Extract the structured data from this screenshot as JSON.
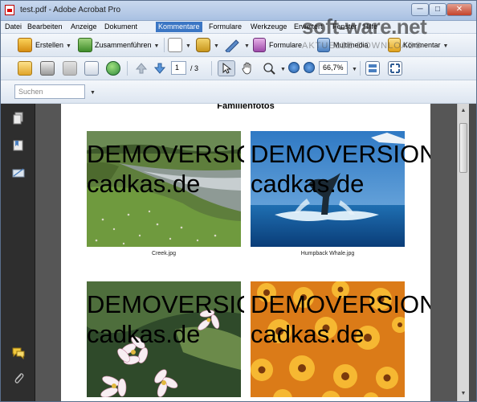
{
  "window": {
    "title": "test.pdf - Adobe Acrobat Pro",
    "minimize": "─",
    "maximize": "□",
    "close": "✕"
  },
  "menu": [
    "Datei",
    "Bearbeiten",
    "Anzeige",
    "Dokument",
    "Kommentare",
    "Formulare",
    "Werkzeuge",
    "Erweitert",
    "Fenster",
    "Hilfe"
  ],
  "menu_active": "Kommentare",
  "toolbar1": {
    "create": "Erstellen",
    "combine": "Zusammenführen",
    "forms": "Formulare",
    "multimedia": "Multimedia",
    "comment": "Kommentar"
  },
  "toolbar2": {
    "current_page": "1",
    "page_count": "/ 3",
    "zoom": "66,7%"
  },
  "search": {
    "placeholder": "Suchen"
  },
  "document": {
    "heading": "Familienfotos",
    "photos": [
      {
        "caption": "Creek.jpg"
      },
      {
        "caption": "Humpback Whale.jpg"
      },
      {
        "caption": ""
      },
      {
        "caption": ""
      }
    ],
    "demo_line1": "DEMOVERSION",
    "demo_line2": "cadkas.de"
  },
  "watermark": {
    "main": "soft-ware.net",
    "sub": "AKTUELLE DOWNLOADS"
  },
  "colors": {
    "menu_active": "#3b76c4",
    "navpanel": "#2e2e2e",
    "workspace": "#565656"
  }
}
